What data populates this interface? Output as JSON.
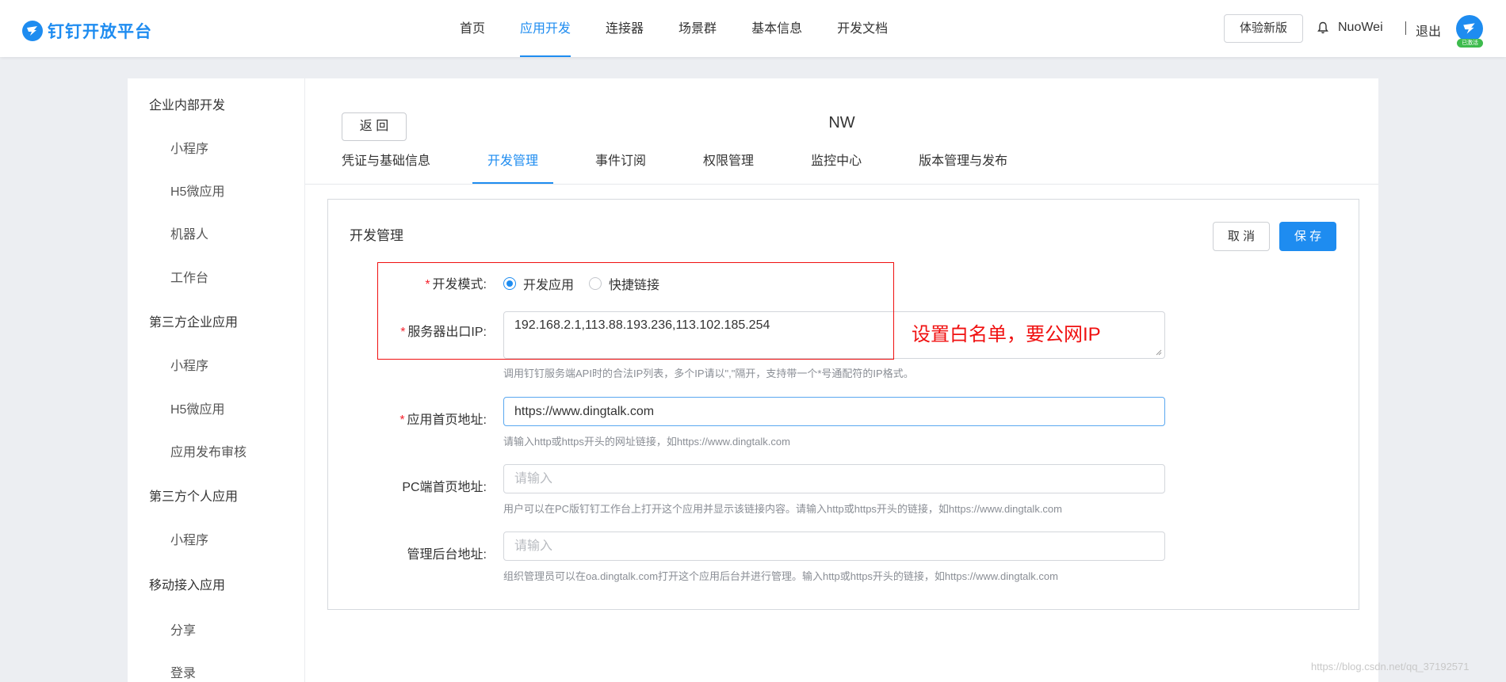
{
  "header": {
    "logo_text": "钉钉开放平台",
    "nav": [
      {
        "label": "首页",
        "active": false
      },
      {
        "label": "应用开发",
        "active": true
      },
      {
        "label": "连接器",
        "active": false
      },
      {
        "label": "场景群",
        "active": false
      },
      {
        "label": "基本信息",
        "active": false
      },
      {
        "label": "开发文档",
        "active": false
      }
    ],
    "try_new_label": "体验新版",
    "username": "NuoWei",
    "separator": "|",
    "logout_label": "退出",
    "verified_badge": "已激活"
  },
  "sidebar": {
    "groups": [
      {
        "title": "企业内部开发",
        "items": [
          "小程序",
          "H5微应用",
          "机器人",
          "工作台"
        ]
      },
      {
        "title": "第三方企业应用",
        "items": [
          "小程序",
          "H5微应用",
          "应用发布审核"
        ]
      },
      {
        "title": "第三方个人应用",
        "items": [
          "小程序"
        ]
      },
      {
        "title": "移动接入应用",
        "items": [
          "分享",
          "登录"
        ]
      }
    ]
  },
  "content": {
    "back_label": "返 回",
    "app_name": "NW",
    "tabs": [
      {
        "label": "凭证与基础信息",
        "active": false
      },
      {
        "label": "开发管理",
        "active": true
      },
      {
        "label": "事件订阅",
        "active": false
      },
      {
        "label": "权限管理",
        "active": false
      },
      {
        "label": "监控中心",
        "active": false
      },
      {
        "label": "版本管理与发布",
        "active": false
      }
    ]
  },
  "panel": {
    "title": "开发管理",
    "cancel_label": "取 消",
    "save_label": "保 存",
    "dev_mode": {
      "label": "开发模式:",
      "required": "*",
      "options": [
        {
          "label": "开发应用",
          "selected": true
        },
        {
          "label": "快捷链接",
          "selected": false
        }
      ]
    },
    "server_ip": {
      "label": "服务器出口IP:",
      "required": "*",
      "value": "192.168.2.1,113.88.193.236,113.102.185.254",
      "hint": "调用钉钉服务端API时的合法IP列表，多个IP请以\",\"隔开，支持带一个*号通配符的IP格式。"
    },
    "homepage_url": {
      "label": "应用首页地址:",
      "required": "*",
      "value": "https://www.dingtalk.com",
      "hint": "请输入http或https开头的网址链接，如https://www.dingtalk.com"
    },
    "pc_homepage_url": {
      "label": "PC端首页地址:",
      "placeholder": "请输入",
      "hint": "用户可以在PC版钉钉工作台上打开这个应用并显示该链接内容。请输入http或https开头的链接，如https://www.dingtalk.com"
    },
    "admin_url": {
      "label": "管理后台地址:",
      "placeholder": "请输入",
      "hint": "组织管理员可以在oa.dingtalk.com打开这个应用后台并进行管理。输入http或https开头的链接，如https://www.dingtalk.com"
    }
  },
  "annotation_text": "设置白名单，要公网IP",
  "watermark": "https://blog.csdn.net/qq_37192571",
  "colors": {
    "accent": "#1e8cf0",
    "required": "#f5222d",
    "annotation": "#f01010"
  }
}
